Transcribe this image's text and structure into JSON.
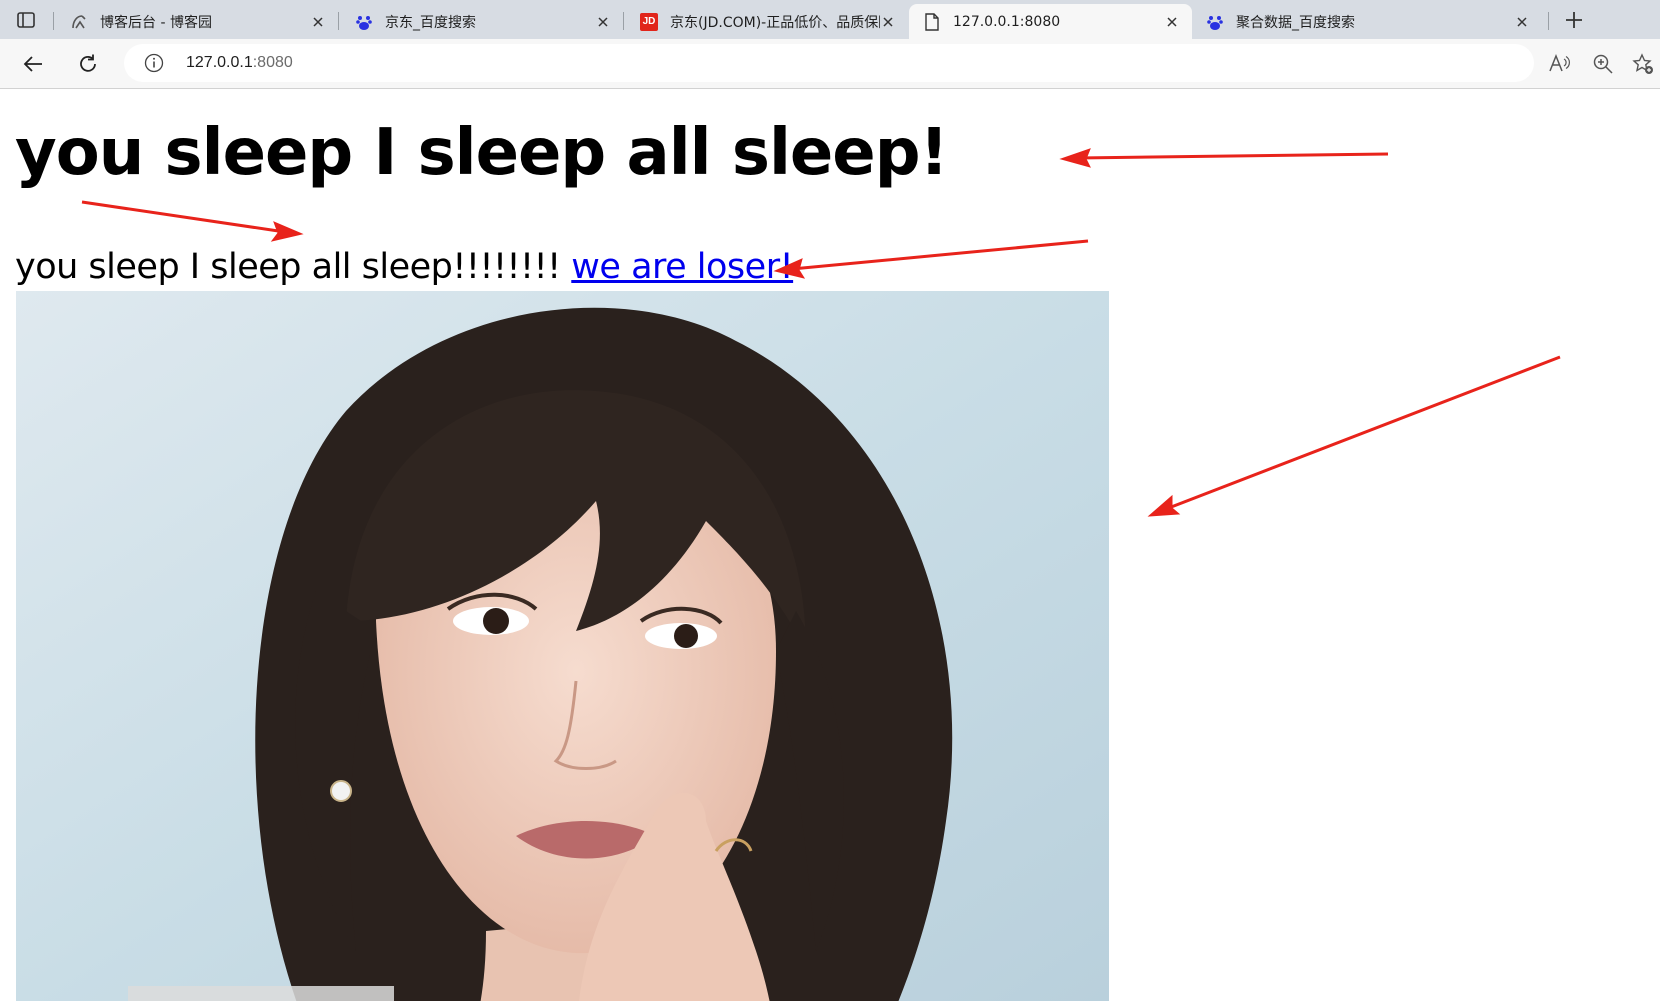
{
  "browser": {
    "tabs": [
      {
        "title": "博客后台 - 博客园",
        "icon": "cnblogs-icon",
        "active": false
      },
      {
        "title": "京东_百度搜索",
        "icon": "baidu-paw-icon",
        "active": false
      },
      {
        "title": "京东(JD.COM)-正品低价、品质保障",
        "icon": "jd-logo-icon",
        "favicon_text": "JD",
        "active": false
      },
      {
        "title": "127.0.0.1:8080",
        "icon": "page-icon",
        "active": true
      },
      {
        "title": "聚合数据_百度搜索",
        "icon": "baidu-paw-icon",
        "active": false
      }
    ],
    "address": {
      "host": "127.0.0.1",
      "port": ":8080"
    },
    "colors": {
      "tabstrip_bg": "#d7dce3",
      "toolbar_bg": "#f7f7f7",
      "link": "#0000ee",
      "annotation_arrow": "#e8231b",
      "baidu_blue": "#2932e1",
      "jd_red": "#e1251b"
    }
  },
  "page": {
    "heading": "you sleep I sleep all sleep!",
    "paragraph_text": "you sleep I sleep all sleep!!!!!!!!",
    "link_text": "we are loser!",
    "image": {
      "subject": "portrait photo of a woman with short dark bob hair, finger to lips, light blue background"
    }
  }
}
